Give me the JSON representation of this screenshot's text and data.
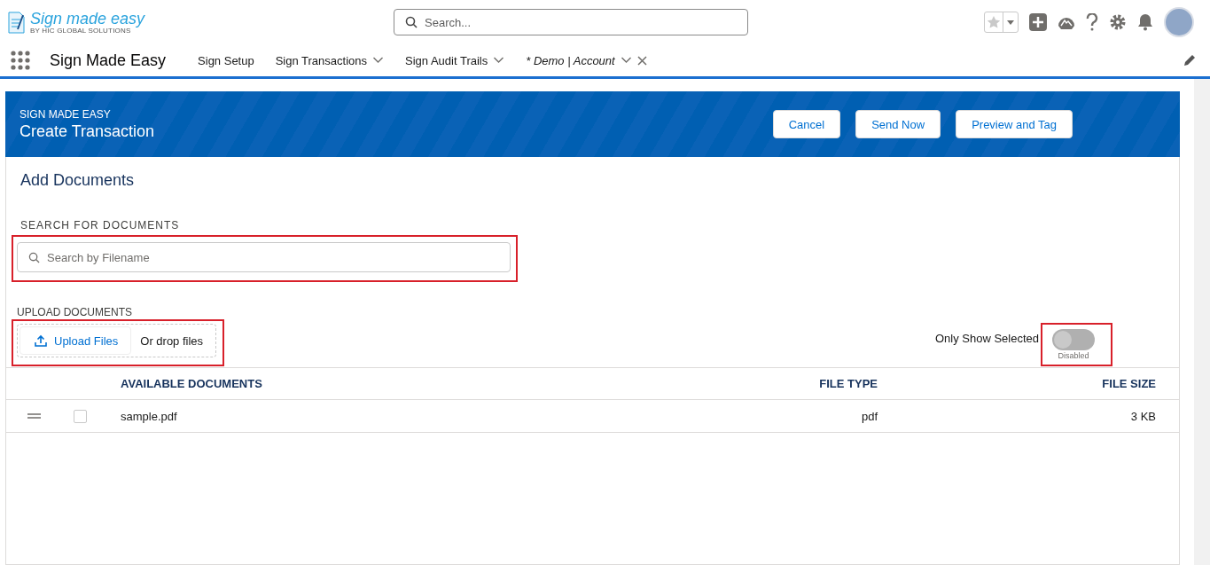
{
  "logo": {
    "title": "Sign made easy",
    "subtitle": "BY HIC GLOBAL SOLUTIONS"
  },
  "global_search": {
    "placeholder": "Search..."
  },
  "app_name": "Sign Made Easy",
  "nav_tabs": [
    {
      "label": "Sign Setup",
      "kind": "page",
      "dropdown": false,
      "closable": false
    },
    {
      "label": "Sign Transactions",
      "kind": "page",
      "dropdown": true,
      "closable": false
    },
    {
      "label": "Sign Audit Trails",
      "kind": "page",
      "dropdown": true,
      "closable": false
    },
    {
      "label": "* Demo | Account",
      "kind": "record",
      "dropdown": true,
      "closable": true
    }
  ],
  "page_header": {
    "eyebrow": "SIGN MADE EASY",
    "title": "Create Transaction",
    "buttons": [
      "Cancel",
      "Send Now",
      "Preview and Tag"
    ]
  },
  "section_title": "Add Documents",
  "document_search": {
    "label": "SEARCH FOR DOCUMENTS",
    "placeholder": "Search by Filename",
    "highlighted": true
  },
  "upload": {
    "label": "UPLOAD DOCUMENTS",
    "button": "Upload Files",
    "drop_text": "Or drop files",
    "highlighted": true
  },
  "selected_filter": {
    "label": "Only Show Selected",
    "on": false,
    "status": "Disabled",
    "highlighted": true
  },
  "table": {
    "columns": [
      "AVAILABLE DOCUMENTS",
      "FILE TYPE",
      "FILE SIZE"
    ],
    "rows": [
      {
        "name": "sample.pdf",
        "type": "pdf",
        "size": "3 KB",
        "checked": false
      }
    ]
  }
}
